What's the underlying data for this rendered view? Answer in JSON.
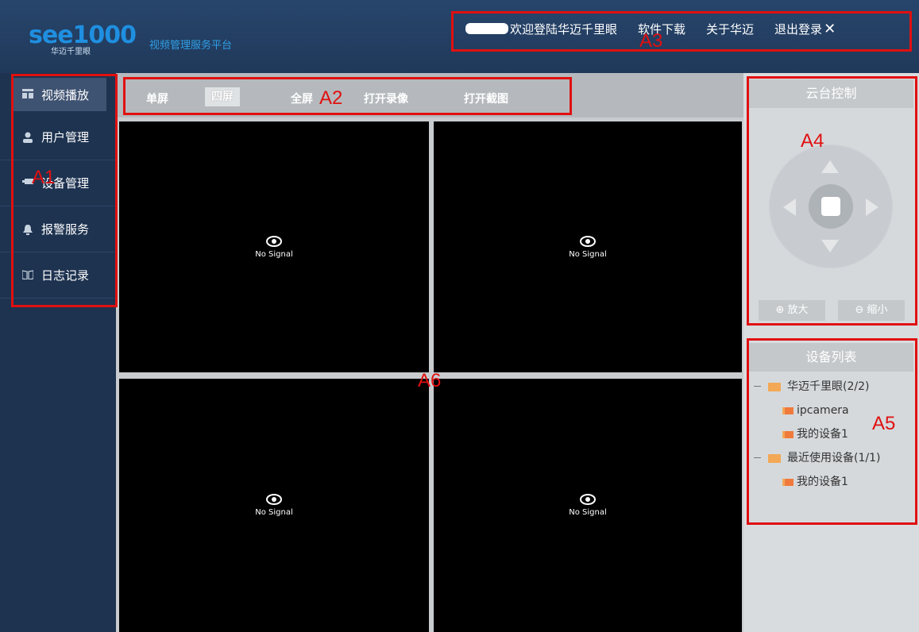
{
  "header": {
    "logo_text": "see1000",
    "logo_sub": "华迈千里眼",
    "platform": "视频管理服务平台",
    "welcome": "欢迎登陆华迈千里眼",
    "nav": [
      "软件下载",
      "关于华迈",
      "退出登录"
    ],
    "close_icon": "✕"
  },
  "sidebar": {
    "items": [
      {
        "label": "视频播放",
        "icon": "grid-icon",
        "active": true
      },
      {
        "label": "用户管理",
        "icon": "user-icon"
      },
      {
        "label": "设备管理",
        "icon": "camera-icon"
      },
      {
        "label": "报警服务",
        "icon": "bell-icon"
      },
      {
        "label": "日志记录",
        "icon": "book-icon"
      }
    ]
  },
  "toolbar": {
    "single": "单屏",
    "quad": "四屏",
    "full": "全屏",
    "record": "打开录像",
    "capture": "打开截图"
  },
  "screens": {
    "no_signal": "No Signal",
    "icon": "eye-icon"
  },
  "ptz": {
    "title": "云台控制",
    "zoom_in": "放大",
    "zoom_out": "缩小"
  },
  "device_list": {
    "title": "设备列表",
    "groups": [
      {
        "label": "华迈千里眼(2/2)",
        "children": [
          "ipcamera",
          "我的设备1"
        ]
      },
      {
        "label": "最近使用设备(1/1)",
        "children": [
          "我的设备1"
        ]
      }
    ]
  },
  "annotations": {
    "a1": "A1",
    "a2": "A2",
    "a3": "A3",
    "a4": "A4",
    "a5": "A5",
    "a6": "A6"
  },
  "colors": {
    "header_bg": "#20395a",
    "sidebar_bg": "#1e3350",
    "accent_blue": "#1f8fe0",
    "annotation_red": "#e01010",
    "folder_orange": "#f3a855"
  }
}
